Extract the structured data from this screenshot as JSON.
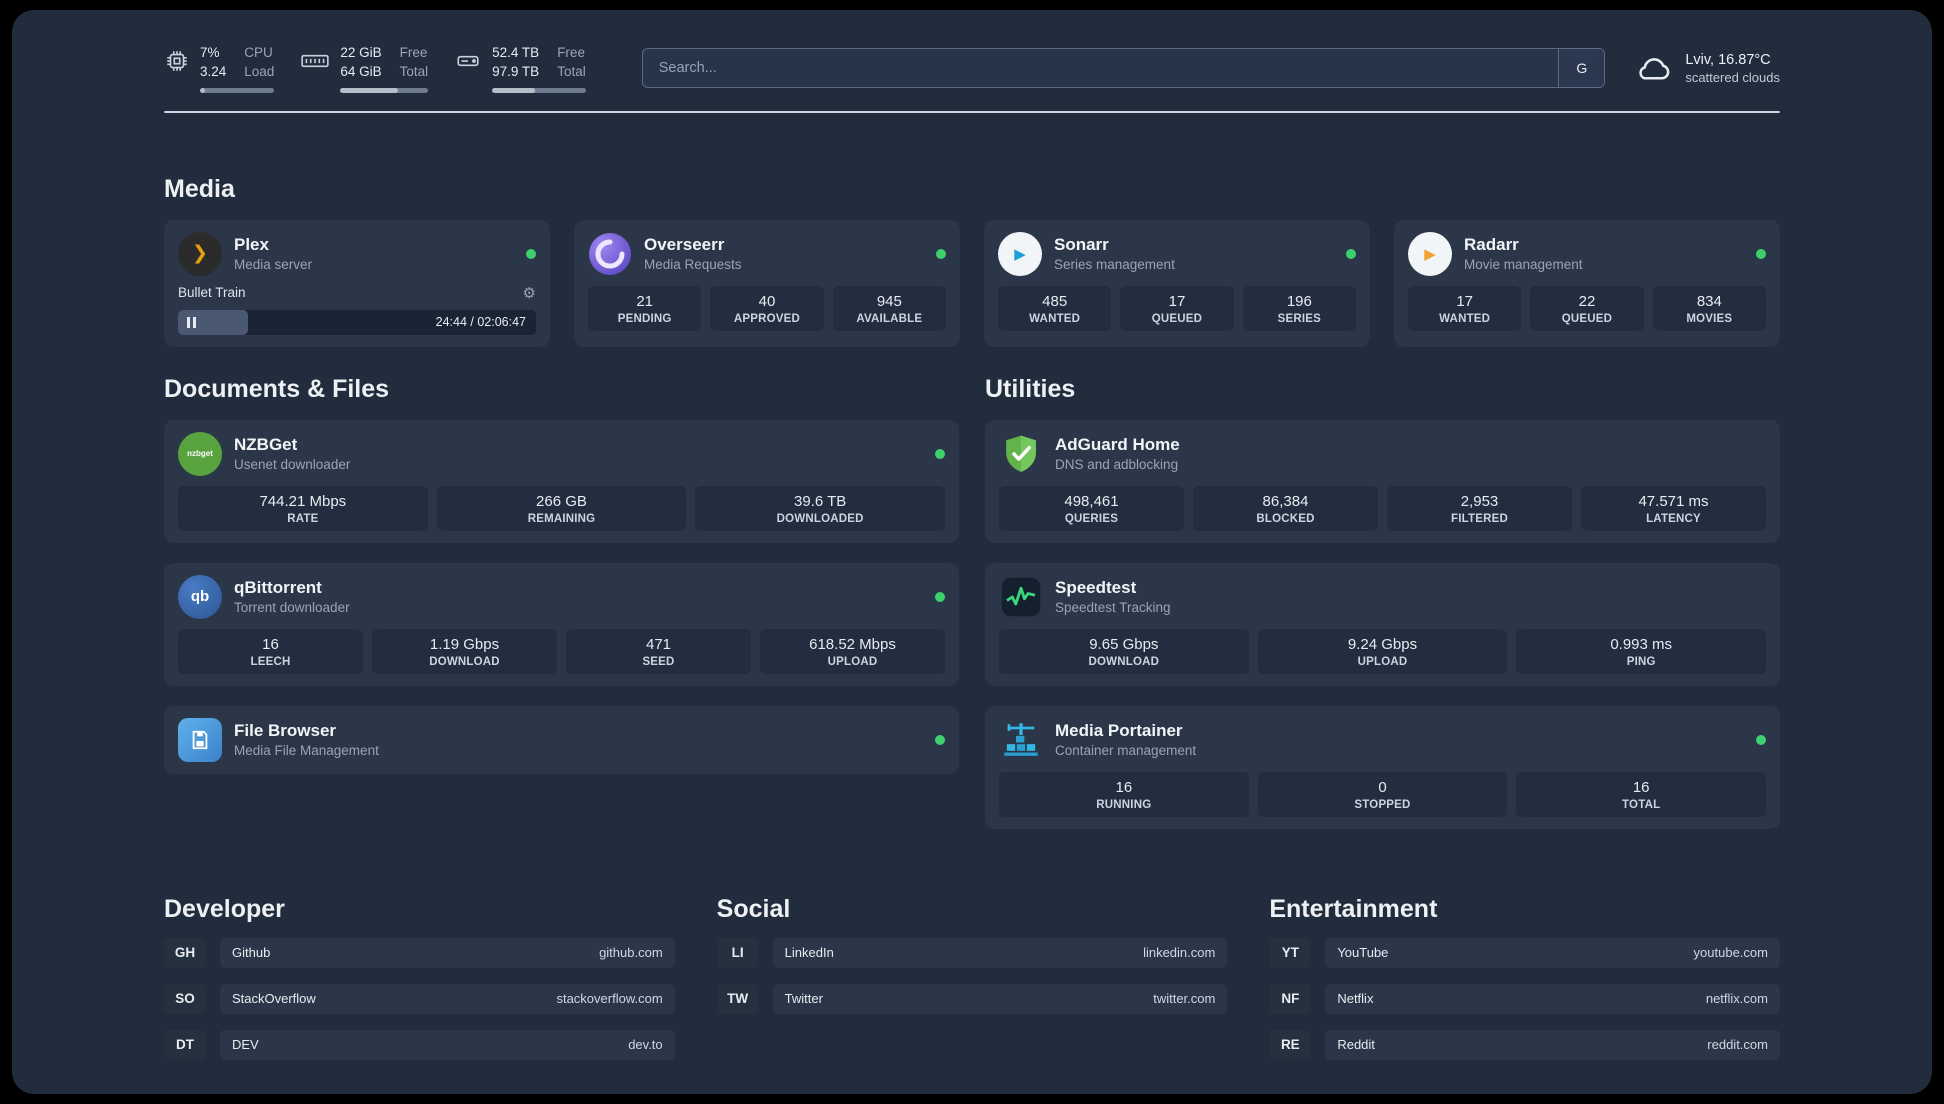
{
  "colors": {
    "status_online": "#3fd06e",
    "page_background": "#212c3d",
    "card_background": "#2b3648",
    "tile_background": "#222d3f",
    "accent_plex": "#e5a00d",
    "accent_overseerr": "#7b5cd6",
    "accent_sonarr": "#1c9fd8",
    "accent_radarr": "#f0a22e",
    "accent_nzbget": "#58a33e",
    "accent_qbittorrent": "#2b5693",
    "accent_filebrowser": "#3b82c9",
    "accent_adguard": "#62b34a",
    "accent_speedtest": "#39d97b",
    "accent_portainer": "#33b7e8"
  },
  "icons": {
    "gear": "⚙"
  },
  "topbar": {
    "cpu": {
      "value1": "7%",
      "value2": "3.24",
      "label1": "CPU",
      "label2": "Load",
      "percent": 7
    },
    "ram": {
      "value1": "22 GiB",
      "value2": "64 GiB",
      "label1": "Free",
      "label2": "Total",
      "percent": 66
    },
    "disk": {
      "value1": "52.4 TB",
      "value2": "97.9 TB",
      "label1": "Free",
      "label2": "Total",
      "percent": 46
    },
    "search": {
      "placeholder": "Search...",
      "button_label": "G"
    },
    "weather": {
      "line1": "Lviv, 16.87°C",
      "line2": "scattered clouds"
    }
  },
  "sections": {
    "media": "Media",
    "documents": "Documents & Files",
    "utilities": "Utilities",
    "developer": "Developer",
    "social": "Social",
    "entertainment": "Entertainment"
  },
  "apps": {
    "plex": {
      "name": "Plex",
      "subtitle": "Media server",
      "icon_glyph": "❯",
      "now_playing": "Bullet Train",
      "time": "24:44 / 02:06:47",
      "progress_percent": 19.5,
      "status": "online"
    },
    "overseerr": {
      "name": "Overseerr",
      "subtitle": "Media Requests",
      "status": "online",
      "stats": [
        {
          "value": "21",
          "label": "PENDING"
        },
        {
          "value": "40",
          "label": "APPROVED"
        },
        {
          "value": "945",
          "label": "AVAILABLE"
        }
      ]
    },
    "sonarr": {
      "name": "Sonarr",
      "subtitle": "Series management",
      "icon_glyph": "▶",
      "status": "online",
      "stats": [
        {
          "value": "485",
          "label": "WANTED"
        },
        {
          "value": "17",
          "label": "QUEUED"
        },
        {
          "value": "196",
          "label": "SERIES"
        }
      ]
    },
    "radarr": {
      "name": "Radarr",
      "subtitle": "Movie management",
      "icon_glyph": "▶",
      "status": "online",
      "stats": [
        {
          "value": "17",
          "label": "WANTED"
        },
        {
          "value": "22",
          "label": "QUEUED"
        },
        {
          "value": "834",
          "label": "MOVIES"
        }
      ]
    },
    "nzbget": {
      "name": "NZBGet",
      "subtitle": "Usenet downloader",
      "icon_text": "nzbget",
      "status": "online",
      "stats": [
        {
          "value": "744.21 Mbps",
          "label": "RATE"
        },
        {
          "value": "266 GB",
          "label": "REMAINING"
        },
        {
          "value": "39.6 TB",
          "label": "DOWNLOADED"
        }
      ]
    },
    "qbittorrent": {
      "name": "qBittorrent",
      "subtitle": "Torrent downloader",
      "icon_text": "qb",
      "status": "online",
      "stats": [
        {
          "value": "16",
          "label": "LEECH"
        },
        {
          "value": "1.19 Gbps",
          "label": "DOWNLOAD"
        },
        {
          "value": "471",
          "label": "SEED"
        },
        {
          "value": "618.52 Mbps",
          "label": "UPLOAD"
        }
      ]
    },
    "filebrowser": {
      "name": "File Browser",
      "subtitle": "Media File Management",
      "status": "online"
    },
    "adguard": {
      "name": "AdGuard Home",
      "subtitle": "DNS and adblocking",
      "stats": [
        {
          "value": "498,461",
          "label": "QUERIES"
        },
        {
          "value": "86,384",
          "label": "BLOCKED"
        },
        {
          "value": "2,953",
          "label": "FILTERED"
        },
        {
          "value": "47.571 ms",
          "label": "LATENCY"
        }
      ]
    },
    "speedtest": {
      "name": "Speedtest",
      "subtitle": "Speedtest Tracking",
      "stats": [
        {
          "value": "9.65 Gbps",
          "label": "DOWNLOAD"
        },
        {
          "value": "9.24 Gbps",
          "label": "UPLOAD"
        },
        {
          "value": "0.993 ms",
          "label": "PING"
        }
      ]
    },
    "portainer": {
      "name": "Media Portainer",
      "subtitle": "Container management",
      "status": "online",
      "stats": [
        {
          "value": "16",
          "label": "RUNNING"
        },
        {
          "value": "0",
          "label": "STOPPED"
        },
        {
          "value": "16",
          "label": "TOTAL"
        }
      ]
    }
  },
  "bookmarks": {
    "developer": [
      {
        "abbr": "GH",
        "name": "Github",
        "url": "github.com"
      },
      {
        "abbr": "SO",
        "name": "StackOverflow",
        "url": "stackoverflow.com"
      },
      {
        "abbr": "DT",
        "name": "DEV",
        "url": "dev.to"
      }
    ],
    "social": [
      {
        "abbr": "LI",
        "name": "LinkedIn",
        "url": "linkedin.com"
      },
      {
        "abbr": "TW",
        "name": "Twitter",
        "url": "twitter.com"
      }
    ],
    "entertainment": [
      {
        "abbr": "YT",
        "name": "YouTube",
        "url": "youtube.com"
      },
      {
        "abbr": "NF",
        "name": "Netflix",
        "url": "netflix.com"
      },
      {
        "abbr": "RE",
        "name": "Reddit",
        "url": "reddit.com"
      }
    ]
  }
}
